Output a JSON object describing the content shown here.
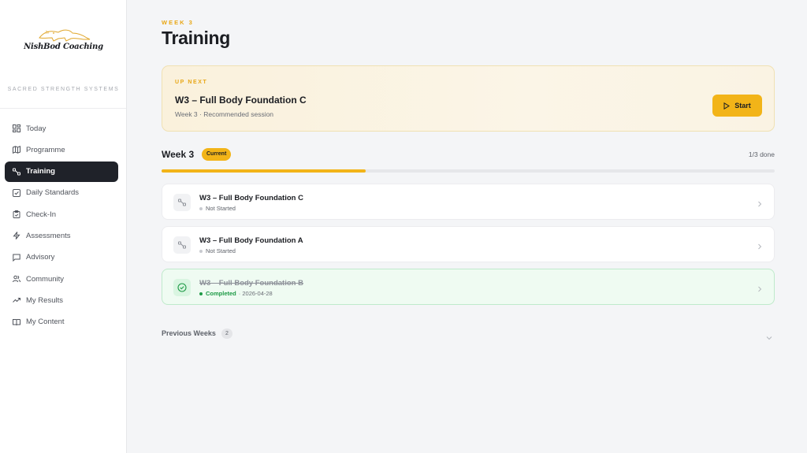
{
  "brand": {
    "logo_text": "NishBod Coaching",
    "logo_subtext": "",
    "tagline": "SACRED STRENGTH SYSTEMS"
  },
  "sidebar": {
    "items": [
      {
        "label": "Today",
        "icon": "grid-icon"
      },
      {
        "label": "Programme",
        "icon": "map-icon"
      },
      {
        "label": "Training",
        "icon": "dumbbell-icon",
        "active": true
      },
      {
        "label": "Daily Standards",
        "icon": "check-square-icon"
      },
      {
        "label": "Check-In",
        "icon": "clipboard-icon"
      },
      {
        "label": "Assessments",
        "icon": "bolt-icon"
      },
      {
        "label": "Advisory",
        "icon": "chat-icon"
      },
      {
        "label": "Community",
        "icon": "users-icon"
      },
      {
        "label": "My Results",
        "icon": "trend-icon"
      },
      {
        "label": "My Content",
        "icon": "book-icon"
      }
    ]
  },
  "header": {
    "kicker": "WEEK 3",
    "title": "Training"
  },
  "up_next": {
    "kicker": "UP NEXT",
    "title": "W3 – Full Body Foundation C",
    "subtitle": "Week 3 · Recommended session",
    "button_label": "Start"
  },
  "week": {
    "label": "Week 3",
    "badge": "Current",
    "done_text": "1/3 done",
    "progress": 0.333
  },
  "sessions": [
    {
      "title": "W3 – Full Body Foundation C",
      "status": "Not Started",
      "date": "",
      "completed": false
    },
    {
      "title": "W3 – Full Body Foundation A",
      "status": "Not Started",
      "date": "",
      "completed": false
    },
    {
      "title": "W3 – Full Body Foundation B",
      "status": "Completed",
      "date": "· 2026-04-28",
      "completed": true
    }
  ],
  "previous_weeks": {
    "label": "Previous Weeks",
    "count": "2"
  },
  "colors": {
    "accent": "#f2b418",
    "sidebar_active": "#1f2229",
    "success": "#1e9a46"
  }
}
